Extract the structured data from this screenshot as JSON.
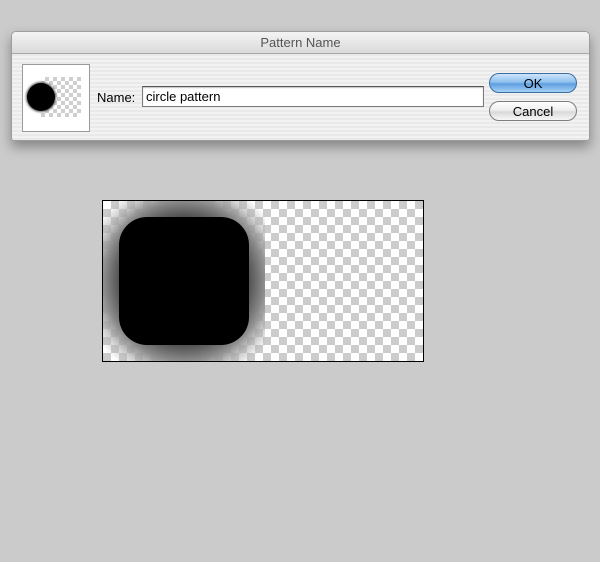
{
  "dialog": {
    "title": "Pattern Name",
    "name_label": "Name:",
    "name_value": "circle pattern",
    "ok_label": "OK",
    "cancel_label": "Cancel"
  },
  "colors": {
    "background": "#cbcbcb",
    "ok_button": "#8ec0ef",
    "pattern_fill": "#000000"
  },
  "icons": {
    "thumbnail": "pattern-thumbnail-icon",
    "preview": "pattern-preview"
  }
}
